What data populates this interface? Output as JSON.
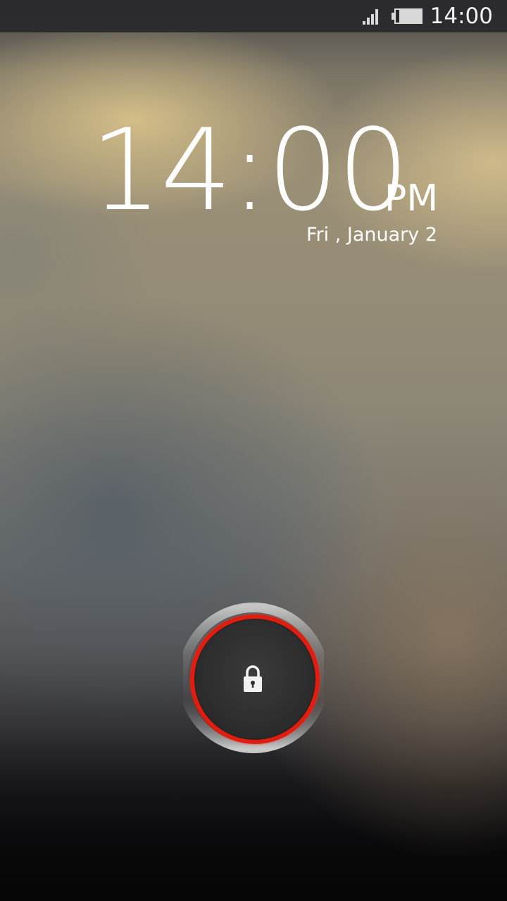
{
  "status_bar": {
    "time": "14:00",
    "signal_icon": "signal-strength-icon",
    "battery_icon": "battery-icon",
    "battery_level": 0.85
  },
  "lock_screen": {
    "clock_time": "14:00",
    "ampm": "PM",
    "date": "Fri , January 2",
    "unlock_icon": "lock-icon",
    "ring_color": "#e11d10"
  }
}
